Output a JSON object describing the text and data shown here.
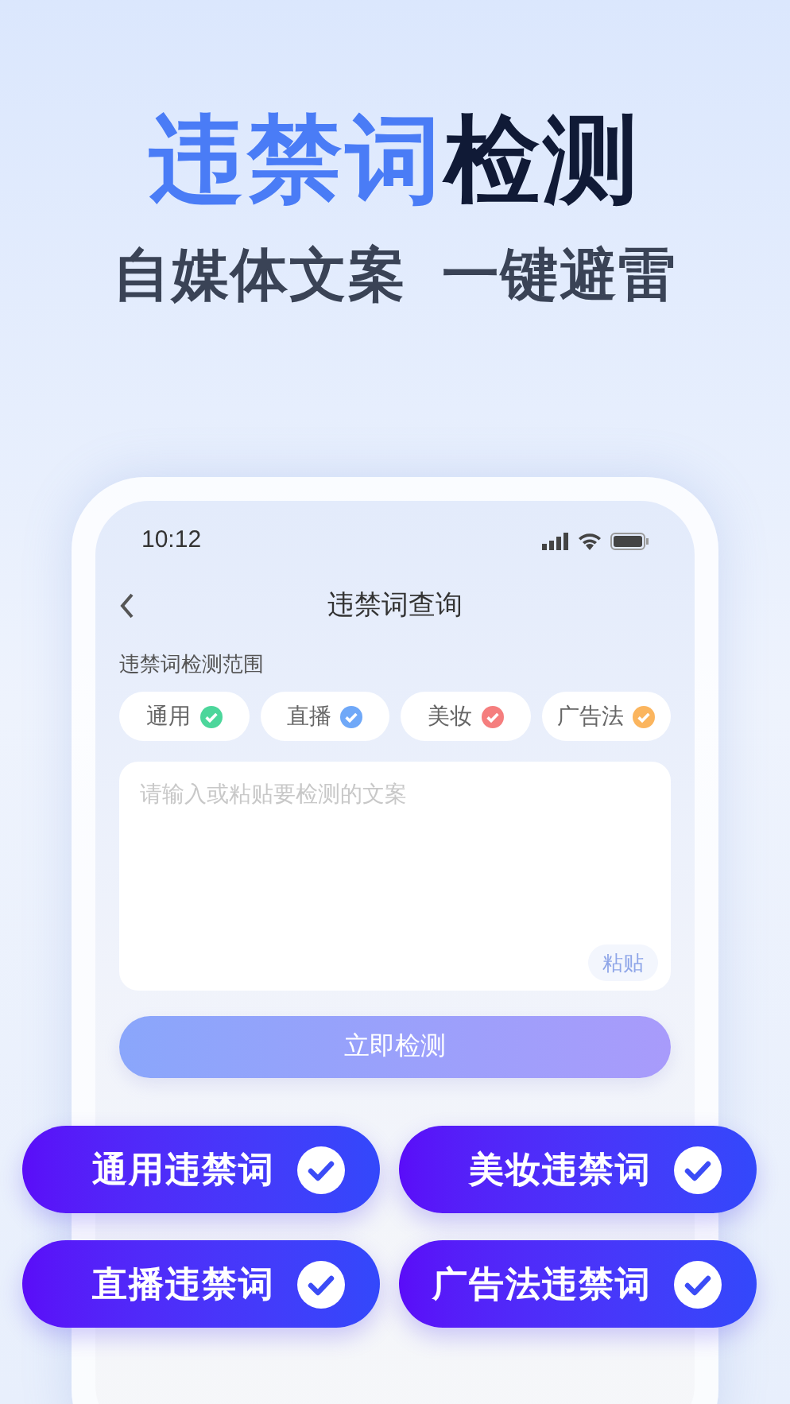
{
  "headline": {
    "highlight": "违禁词",
    "rest": "检测"
  },
  "subtitle": "自媒体文案  一键避雷",
  "phone": {
    "status_bar": {
      "time": "10:12"
    },
    "nav": {
      "title": "违禁词查询"
    },
    "scope_label": "违禁词检测范围",
    "chips": [
      {
        "label": "通用",
        "color": "#4cd69b"
      },
      {
        "label": "直播",
        "color": "#6fa8f8"
      },
      {
        "label": "美妆",
        "color": "#f57e7e"
      },
      {
        "label": "广告法",
        "color": "#fbb55e"
      }
    ],
    "text_area": {
      "placeholder": "请输入或粘贴要检测的文案",
      "paste_button": "粘贴"
    },
    "check_button": "立即检测"
  },
  "feature_pills": [
    {
      "label": "通用违禁词"
    },
    {
      "label": "美妆违禁词"
    },
    {
      "label": "直播违禁词"
    },
    {
      "label": "广告法违禁词"
    }
  ]
}
